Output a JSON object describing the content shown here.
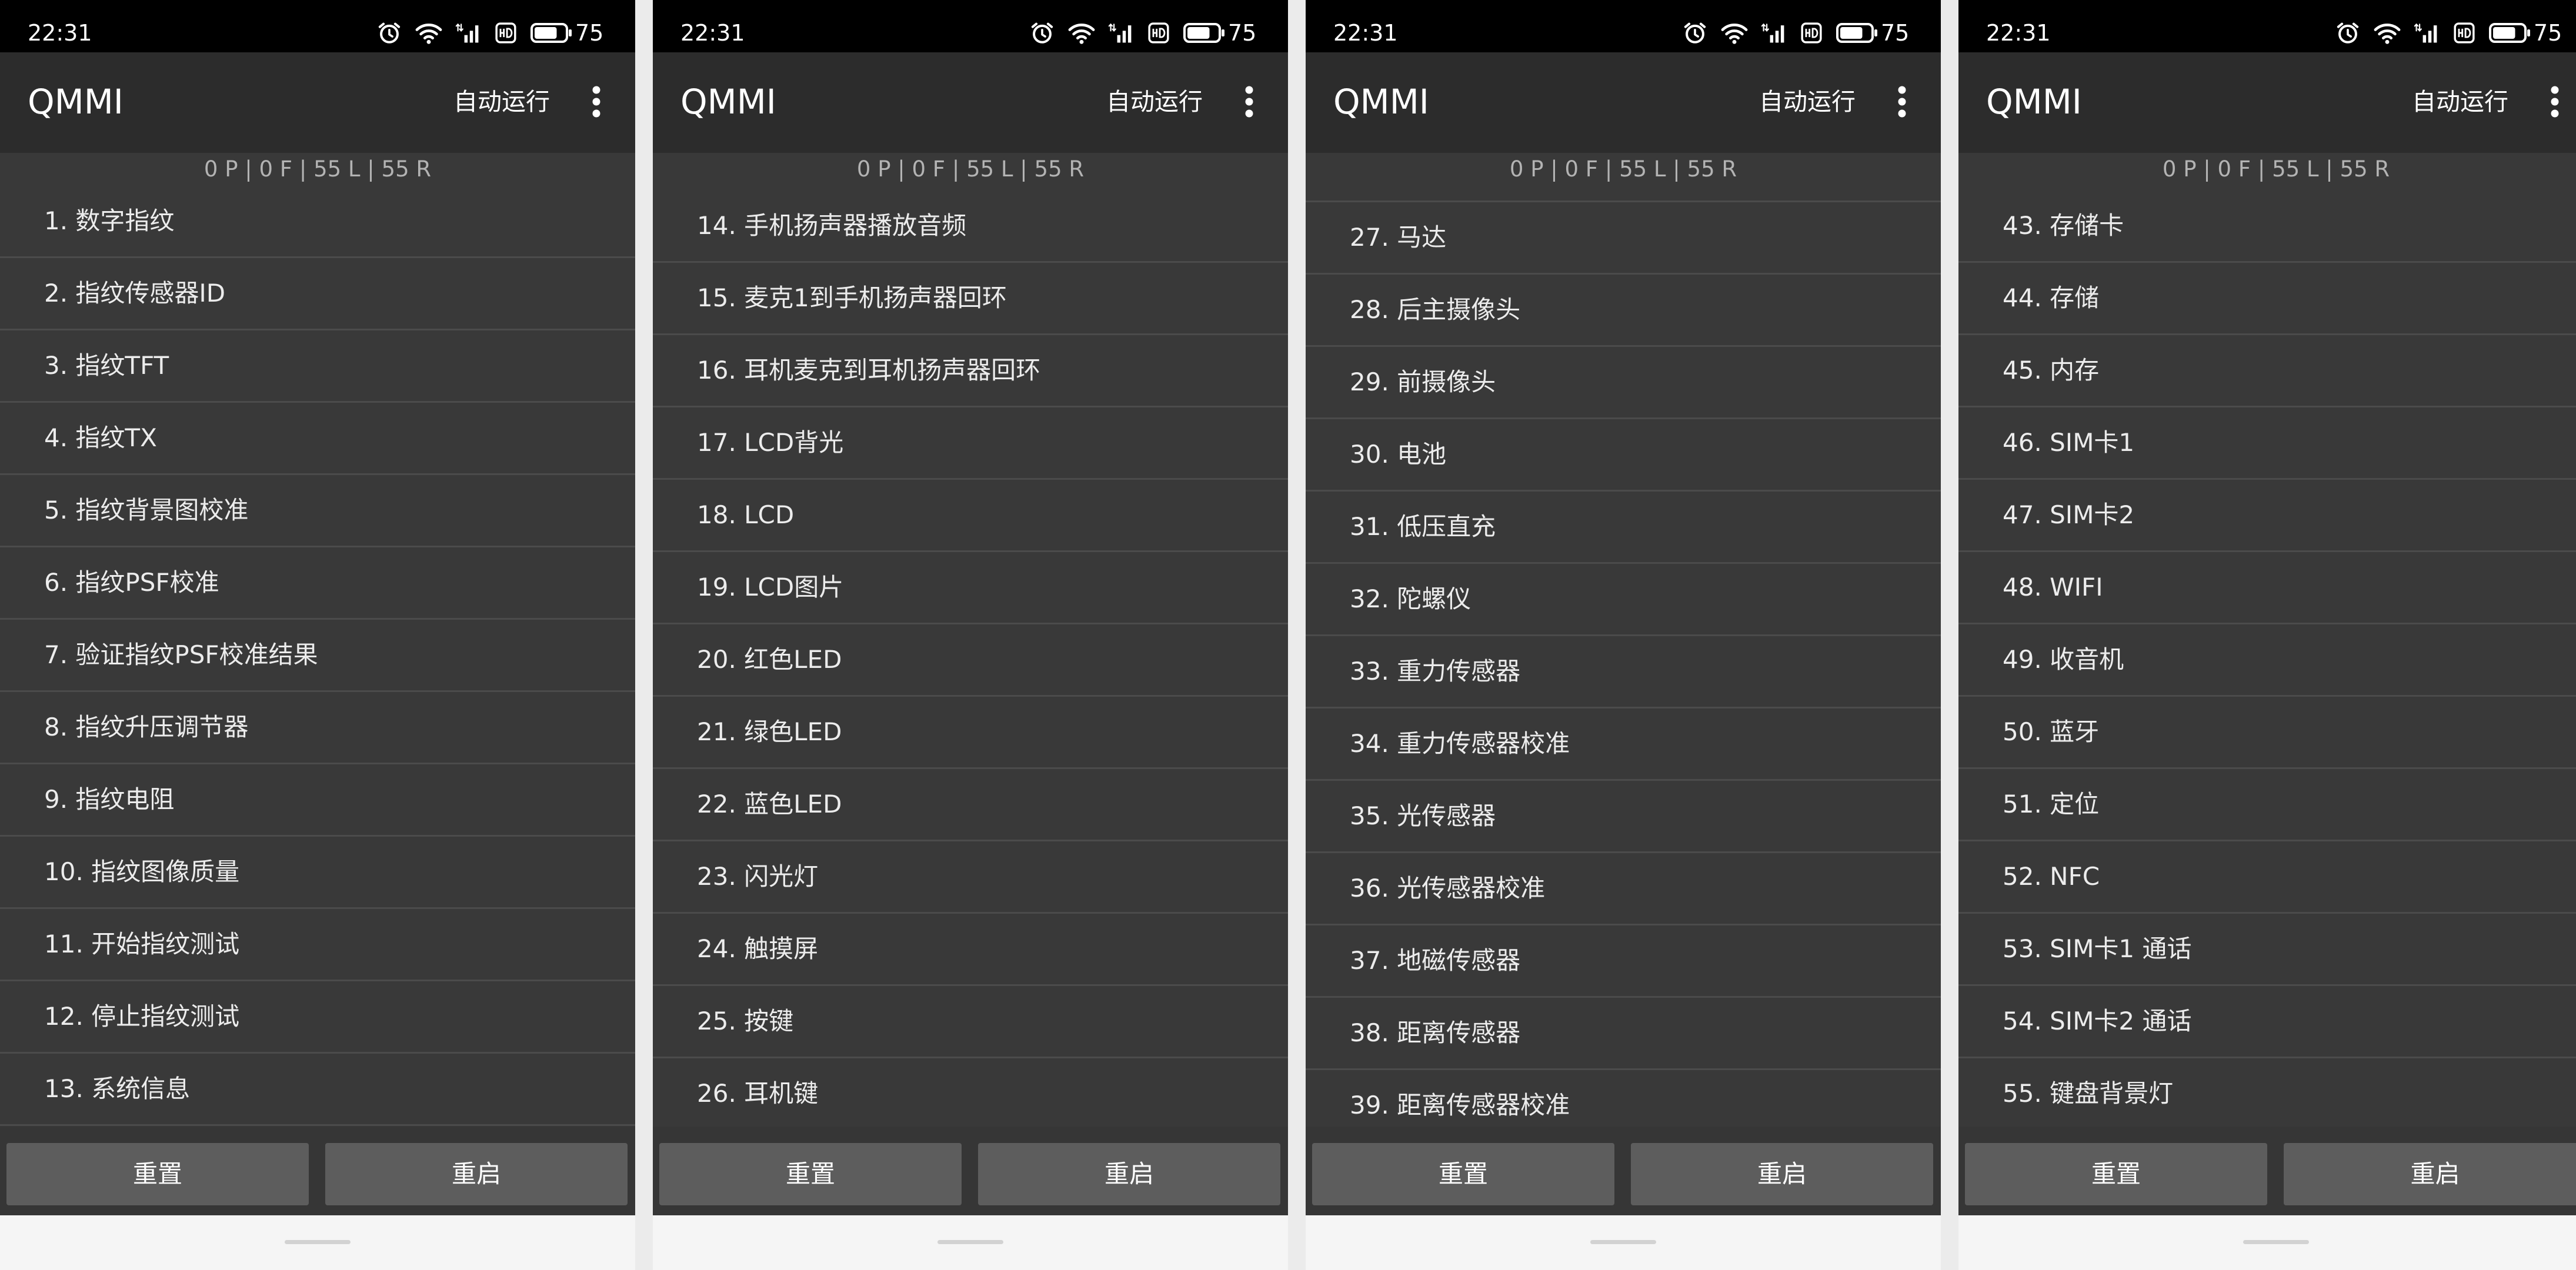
{
  "theme": {
    "status_bar": "#000000",
    "app_bar": "#2c2c2c",
    "list_background": "#393939",
    "divider": "#4b4b4b",
    "button": "#5d5d5d",
    "button_bar": "#363636",
    "text": "#ececec",
    "summary_text": "#b3b3b3",
    "nav_bar": "#f5f5f5",
    "page": "#ebebeb"
  },
  "status": {
    "time": "22:31",
    "battery": "75",
    "icons": [
      "alarm-icon",
      "wifi-icon",
      "signal-icon",
      "hd-icon",
      "battery-icon"
    ]
  },
  "app_bar": {
    "title": "QMMI",
    "action": "自动运行",
    "menu_icon": "overflow-menu-icon"
  },
  "summary": "0 P | 0 F | 55 L | 55 R",
  "buttons": {
    "reset": "重置",
    "restart": "重启"
  },
  "screens": [
    {
      "items": [
        "1. 数字指纹",
        "2. 指纹传感器ID",
        "3. 指纹TFT",
        "4. 指纹TX",
        "5. 指纹背景图校准",
        "6. 指纹PSF校准",
        "7. 验证指纹PSF校准结果",
        "8. 指纹升压调节器",
        "9. 指纹电阻",
        "10. 指纹图像质量",
        "11. 开始指纹测试",
        "12. 停止指纹测试",
        "13. 系统信息"
      ]
    },
    {
      "items": [
        "14. 手机扬声器播放音频",
        "15. 麦克1到手机扬声器回环",
        "16. 耳机麦克到耳机扬声器回环",
        "17. LCD背光",
        "18. LCD",
        "19. LCD图片",
        "20. 红色LED",
        "21. 绿色LED",
        "22. 蓝色LED",
        "23. 闪光灯",
        "24. 触摸屏",
        "25. 按键",
        "26. 耳机键"
      ]
    },
    {
      "items": [
        "27. 马达",
        "28. 后主摄像头",
        "29. 前摄像头",
        "30. 电池",
        "31. 低压直充",
        "32. 陀螺仪",
        "33. 重力传感器",
        "34. 重力传感器校准",
        "35. 光传感器",
        "36. 光传感器校准",
        "37. 地磁传感器",
        "38. 距离传感器",
        "39. 距离传感器校准"
      ]
    },
    {
      "items": [
        "43. 存储卡",
        "44. 存储",
        "45. 内存",
        "46. SIM卡1",
        "47. SIM卡2",
        "48. WIFI",
        "49. 收音机",
        "50. 蓝牙",
        "51. 定位",
        "52. NFC",
        "53. SIM卡1 通话",
        "54. SIM卡2 通话",
        "55. 键盘背景灯"
      ]
    }
  ]
}
